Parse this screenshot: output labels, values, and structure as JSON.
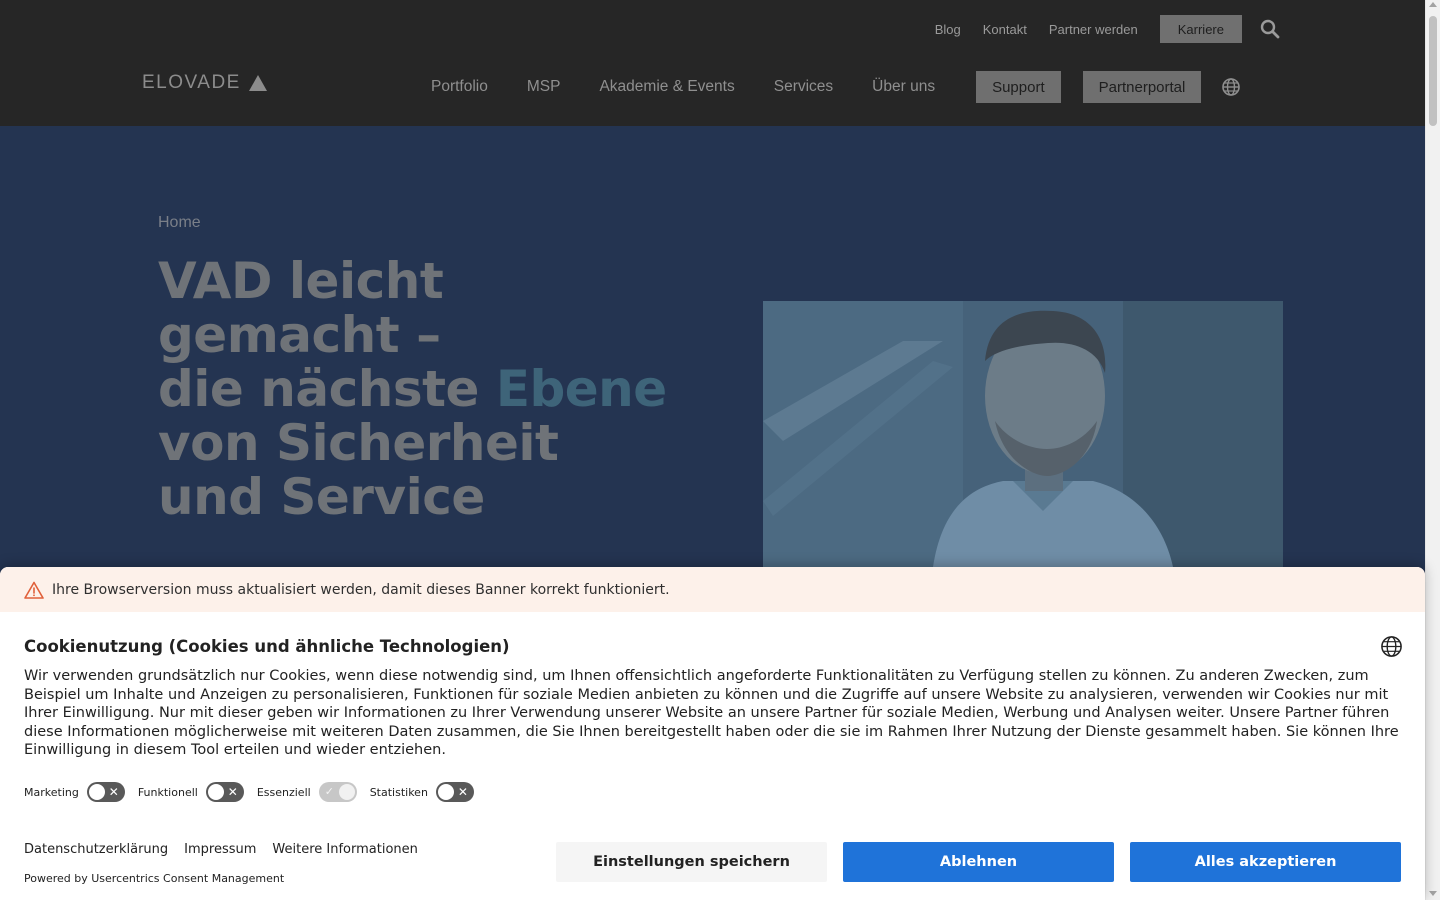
{
  "utility_nav": {
    "links": [
      "Blog",
      "Kontakt",
      "Partner werden"
    ],
    "karriere": "Karriere",
    "search_icon": "search-icon"
  },
  "logo": {
    "text": "ELOVADE"
  },
  "main_nav": {
    "items": [
      "Portfolio",
      "MSP",
      "Akademie & Events",
      "Services",
      "Über uns"
    ],
    "support": "Support",
    "partnerportal": "Partnerportal",
    "language_icon": "globe-icon"
  },
  "hero": {
    "breadcrumb": "Home",
    "headline": {
      "line1": "VAD leicht",
      "line2": "gemacht –",
      "line3_start": "die nächste ",
      "line3_accent": "Ebene",
      "line4": "von Sicherheit",
      "line5": "und Service"
    }
  },
  "cookie_banner": {
    "warning": "Ihre Browserversion muss aktualisiert werden, damit dieses Banner korrekt funktioniert.",
    "title": "Cookienutzung (Cookies und ähnliche Technologien)",
    "body": "Wir verwenden grundsätzlich nur Cookies, wenn diese notwendig sind, um Ihnen offensichtlich angeforderte Funktionalitäten zu Verfügung stellen zu können. Zu anderen Zwecken, zum Beispiel um Inhalte und Anzeigen zu personalisieren, Funktionen für soziale Medien anbieten zu können und die Zugriffe auf unsere Website zu analysieren, verwenden wir Cookies nur mit Ihrer Einwilligung. Nur mit dieser geben wir Informationen zu Ihrer Verwendung unserer Website an unsere Partner für soziale Medien, Werbung und Analysen weiter. Unsere Partner führen diese Informationen möglicherweise mit weiteren Daten zusammen, die Sie Ihnen bereitgestellt haben oder die sie im Rahmen Ihrer Nutzung der Dienste gesammelt haben. Sie können Ihre Einwilligung in diesem Tool erteilen und wieder entziehen.",
    "toggles": [
      {
        "label": "Marketing",
        "state": "off"
      },
      {
        "label": "Funktionell",
        "state": "off"
      },
      {
        "label": "Essenziell",
        "state": "on-disabled"
      },
      {
        "label": "Statistiken",
        "state": "off"
      }
    ],
    "links": [
      "Datenschutzerklärung",
      "Impressum",
      "Weitere Informationen"
    ],
    "powered_by": "Powered by Usercentrics Consent Management",
    "buttons": {
      "save": "Einstellungen speichern",
      "deny": "Ablehnen",
      "accept": "Alles akzeptieren"
    },
    "colors": {
      "primary_button": "#1f73d9",
      "warning_bg": "#fdf1ea",
      "warning_icon": "#e0603a"
    }
  }
}
